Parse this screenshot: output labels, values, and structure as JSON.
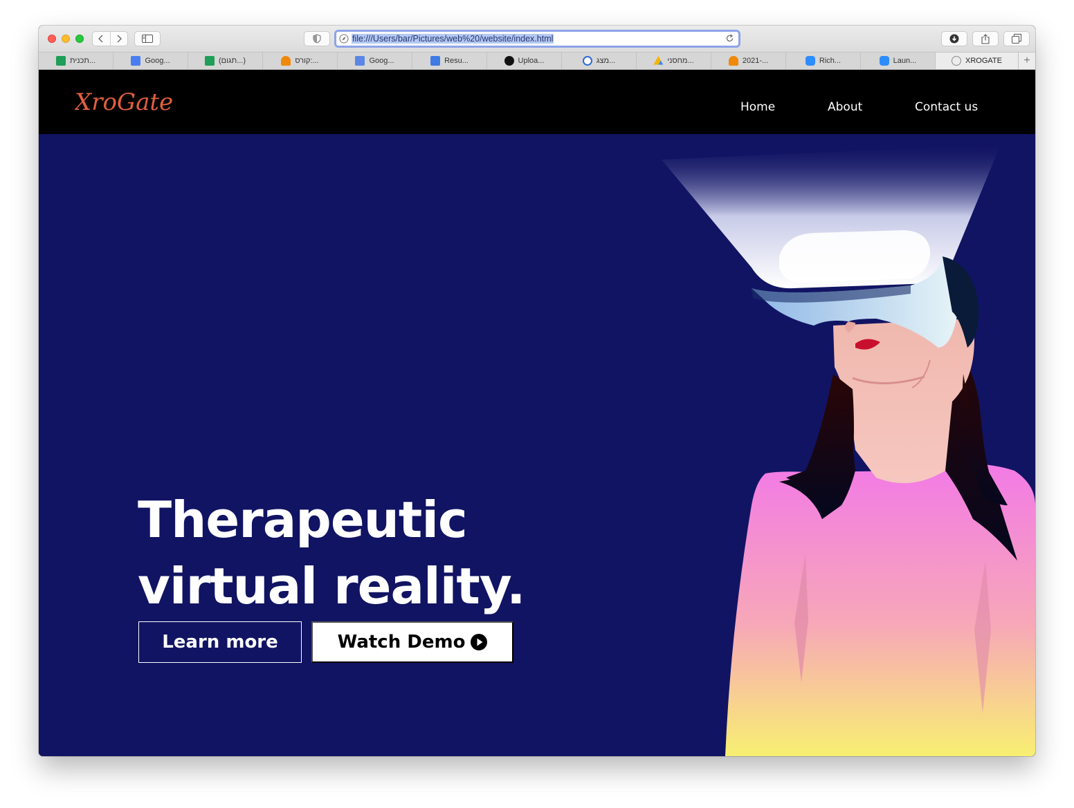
{
  "browser": {
    "address_url": "file:///Users/bar/Pictures/web%20/website/index.html",
    "bookmarks": [
      {
        "label": "תכנית...",
        "icon": "sheets-icon",
        "color": "#1e9e57"
      },
      {
        "label": "Goog...",
        "icon": "docs-icon",
        "color": "#4a7ef0"
      },
      {
        "label": "(תגום...)",
        "icon": "sheets-icon",
        "color": "#1e9e57"
      },
      {
        "label": "קורס:...",
        "icon": "moodle-icon",
        "color": "#f0880a"
      },
      {
        "label": "Goog...",
        "icon": "translate-icon",
        "color": "#5b86e5"
      },
      {
        "label": "Resu...",
        "icon": "resume-icon",
        "color": "#3f7be4"
      },
      {
        "label": "Uploa...",
        "icon": "github-icon",
        "color": "#111111"
      },
      {
        "label": "מצג...",
        "icon": "slides-icon",
        "color": "#2d6bd6"
      },
      {
        "label": "מחסני...",
        "icon": "drive-icon",
        "color": "#f4b400"
      },
      {
        "label": "2021-...",
        "icon": "moodle-icon",
        "color": "#f0880a"
      },
      {
        "label": "Rich...",
        "icon": "zoom-icon",
        "color": "#2d8cff"
      },
      {
        "label": "Laun...",
        "icon": "zoom-icon",
        "color": "#2d8cff"
      },
      {
        "label": "XROGATE",
        "icon": "compass-icon",
        "color": "#888888"
      }
    ]
  },
  "site": {
    "logo_text": "XroGate",
    "nav": {
      "home": "Home",
      "about": "About",
      "contact": "Contact us"
    },
    "hero": {
      "headline_line1": "Therapeutic",
      "headline_line2": "virtual reality.",
      "learn_more": "Learn more",
      "watch_demo": "Watch Demo"
    }
  },
  "colors": {
    "hero_background": "#111463",
    "nav_background": "#000000",
    "logo": "#e0603f",
    "sweater_top": "#f27ae6",
    "sweater_bottom": "#f8ef72"
  }
}
